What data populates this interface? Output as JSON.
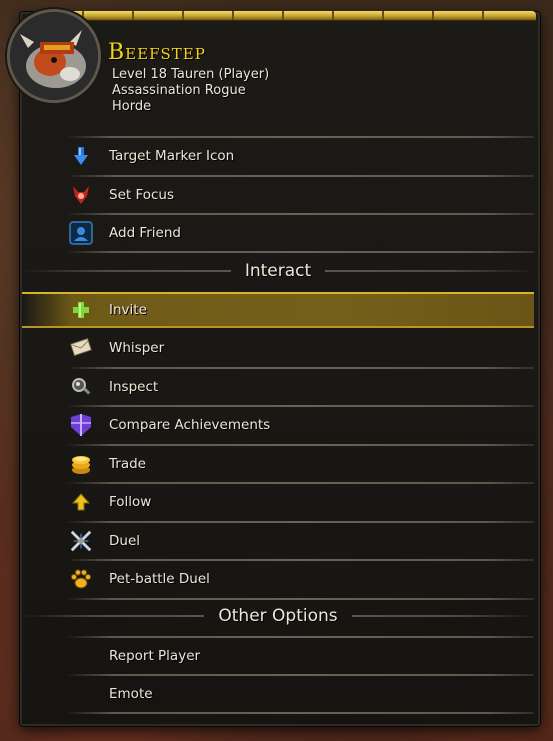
{
  "player": {
    "name": "Beefstep",
    "level_line": "Level 18 Tauren (Player)",
    "spec_line": "Assassination Rogue",
    "faction_line": "Horde"
  },
  "top_items": [
    {
      "label": "Target Marker Icon",
      "icon": "target-marker-icon"
    },
    {
      "label": "Set Focus",
      "icon": "focus-icon"
    },
    {
      "label": "Add Friend",
      "icon": "add-friend-icon"
    }
  ],
  "interact": {
    "title": "Interact",
    "items": [
      {
        "label": "Invite",
        "icon": "plus-icon",
        "highlighted": true
      },
      {
        "label": "Whisper",
        "icon": "scroll-icon"
      },
      {
        "label": "Inspect",
        "icon": "magnifier-icon"
      },
      {
        "label": "Compare Achievements",
        "icon": "shield-icon"
      },
      {
        "label": "Trade",
        "icon": "coins-icon"
      },
      {
        "label": "Follow",
        "icon": "arrow-up-icon"
      },
      {
        "label": "Duel",
        "icon": "crossed-swords-icon"
      },
      {
        "label": "Pet-battle Duel",
        "icon": "paw-icon"
      }
    ]
  },
  "other": {
    "title": "Other Options",
    "items": [
      {
        "label": "Report Player"
      },
      {
        "label": "Emote"
      }
    ]
  },
  "colors": {
    "name_gold": "#f6d21c",
    "highlight": "#d8b429",
    "text": "#ece6d8"
  }
}
